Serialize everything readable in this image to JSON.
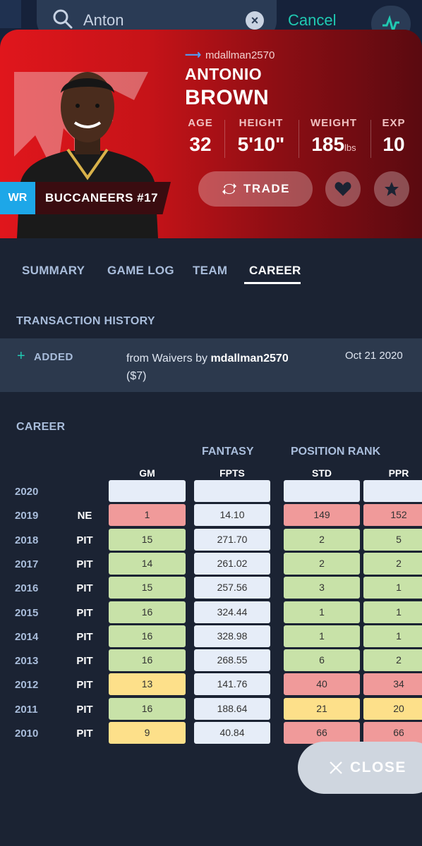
{
  "search": {
    "query": "Anton",
    "cancel_label": "Cancel"
  },
  "player": {
    "owner": "mdallman2570",
    "first_name": "ANTONIO",
    "last_name": "BROWN",
    "position": "WR",
    "team": "BUCCANEERS #17",
    "stats": [
      {
        "label": "AGE",
        "value": "32",
        "unit": ""
      },
      {
        "label": "HEIGHT",
        "value": "5'10\"",
        "unit": ""
      },
      {
        "label": "WEIGHT",
        "value": "185",
        "unit": "lbs"
      },
      {
        "label": "EXP",
        "value": "10",
        "unit": ""
      }
    ],
    "trade_label": "TRADE"
  },
  "tabs": [
    "SUMMARY",
    "GAME LOG",
    "TEAM",
    "CAREER"
  ],
  "transactions": {
    "title": "TRANSACTION HISTORY",
    "items": [
      {
        "type": "ADDED",
        "desc_prefix": "from Waivers by",
        "user": "mdallman2570",
        "amount": "($7)",
        "date": "Oct 21 2020"
      }
    ]
  },
  "career": {
    "title": "CAREER",
    "group_fantasy": "FANTASY",
    "group_rank": "POSITION RANK",
    "columns": [
      "GM",
      "FPTS",
      "STD",
      "PPR"
    ],
    "rows": [
      {
        "year": "2020",
        "team": "",
        "gm": "",
        "fpts": "",
        "std": "",
        "ppr": ""
      },
      {
        "year": "2019",
        "team": "NE",
        "gm": "1",
        "fpts": "14.10",
        "std": "149",
        "ppr": "152"
      },
      {
        "year": "2018",
        "team": "PIT",
        "gm": "15",
        "fpts": "271.70",
        "std": "2",
        "ppr": "5"
      },
      {
        "year": "2017",
        "team": "PIT",
        "gm": "14",
        "fpts": "261.02",
        "std": "2",
        "ppr": "2"
      },
      {
        "year": "2016",
        "team": "PIT",
        "gm": "15",
        "fpts": "257.56",
        "std": "3",
        "ppr": "1"
      },
      {
        "year": "2015",
        "team": "PIT",
        "gm": "16",
        "fpts": "324.44",
        "std": "1",
        "ppr": "1"
      },
      {
        "year": "2014",
        "team": "PIT",
        "gm": "16",
        "fpts": "328.98",
        "std": "1",
        "ppr": "1"
      },
      {
        "year": "2013",
        "team": "PIT",
        "gm": "16",
        "fpts": "268.55",
        "std": "6",
        "ppr": "2"
      },
      {
        "year": "2012",
        "team": "PIT",
        "gm": "13",
        "fpts": "141.76",
        "std": "40",
        "ppr": "34"
      },
      {
        "year": "2011",
        "team": "PIT",
        "gm": "16",
        "fpts": "188.64",
        "std": "21",
        "ppr": "20"
      },
      {
        "year": "2010",
        "team": "PIT",
        "gm": "9",
        "fpts": "40.84",
        "std": "66",
        "ppr": "66"
      }
    ],
    "colors": {
      "good": "#c8e2a8",
      "mid": "#fde08a",
      "bad": "#f09a9a",
      "neutral": "#e6edf8"
    }
  },
  "close_label": "CLOSE",
  "colors": {
    "accent": "#20c9b2",
    "position_badge": "#1da7e8",
    "hero_red": "#d3161b"
  }
}
